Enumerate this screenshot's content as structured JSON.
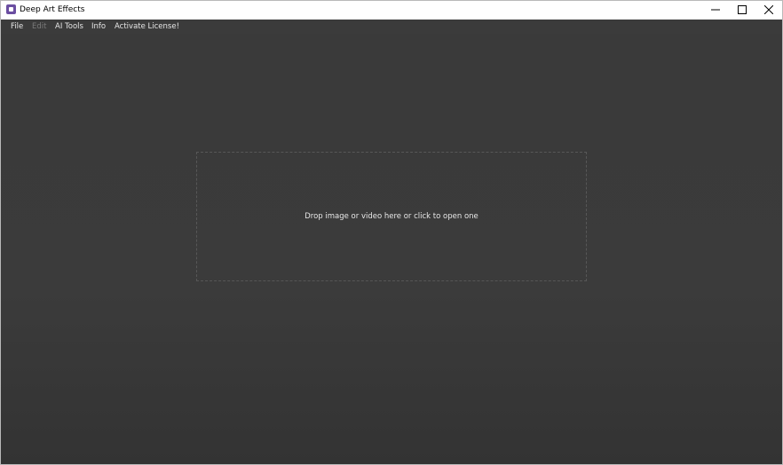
{
  "window": {
    "title": "Deep Art Effects",
    "icon": "app-logo-icon",
    "controls": [
      "minimize-icon",
      "maximize-icon",
      "close-icon"
    ]
  },
  "menu": {
    "file": "File",
    "edit": "Edit",
    "ai_tools": "AI Tools",
    "info": "Info",
    "activate_license": "Activate License!"
  },
  "dropzone": {
    "text": "Drop image or video here or click to open one"
  },
  "colors": {
    "background": "#3b3b3b",
    "titlebar": "#ffffff",
    "menu_text": "#e6e6e6",
    "menu_disabled": "#7a7a7a",
    "dropzone_border": "#575757",
    "app_icon": "#6b4ea1"
  }
}
